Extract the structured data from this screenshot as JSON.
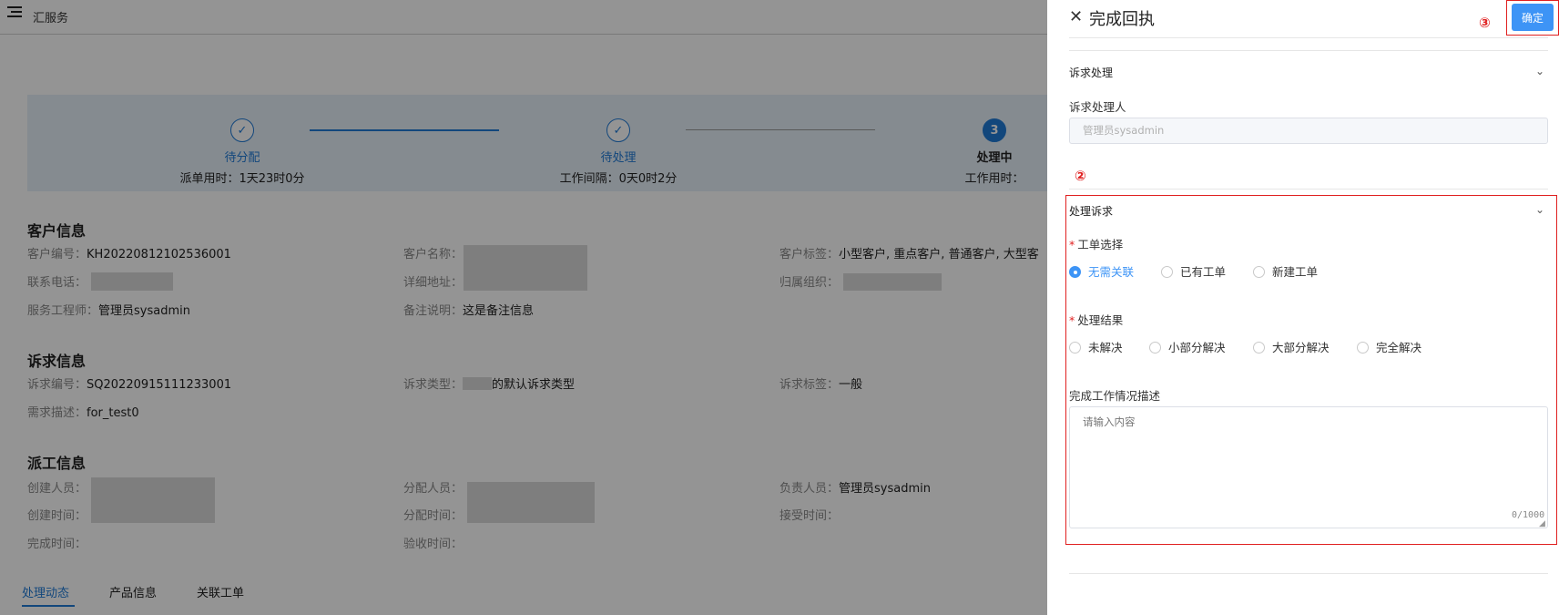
{
  "app": {
    "title": "汇服务"
  },
  "steps": [
    {
      "icon": "check-icon",
      "mark": "✓",
      "label": "待分配",
      "sub": "派单用时：1天23时0分"
    },
    {
      "icon": "check-icon",
      "mark": "✓",
      "label": "待处理",
      "sub": "工作间隔：0天0时2分"
    },
    {
      "icon": "step-number",
      "mark": "3",
      "label": "处理中",
      "sub": "工作用时："
    }
  ],
  "customer": {
    "title": "客户信息",
    "code_label": "客户编号：",
    "code": "KH20220812102536001",
    "name_label": "客户名称：",
    "tags_label": "客户标签：",
    "tags": "小型客户, 重点客户, 普通客户, 大型客",
    "phone_label": "联系电话：",
    "address_label": "详细地址：",
    "org_label": "归属组织：",
    "engineer_label": "服务工程师：",
    "engineer": "管理员sysadmin",
    "remark_label": "备注说明：",
    "remark": "这是备注信息"
  },
  "request": {
    "title": "诉求信息",
    "code_label": "诉求编号：",
    "code": "SQ20220915111233001",
    "type_label": "诉求类型：",
    "type": "的默认诉求类型",
    "tag_label": "诉求标签：",
    "tag": "一般",
    "desc_label": "需求描述：",
    "desc": "for_test0"
  },
  "dispatch": {
    "title": "派工信息",
    "creator_label": "创建人员：",
    "assignee_label": "分配人员：",
    "owner_label": "负责人员：",
    "owner": "管理员sysadmin",
    "created_label": "创建时间：",
    "assigned_label": "分配时间：",
    "accepted_label": "接受时间：",
    "finished_label": "完成时间：",
    "checked_label": "验收时间："
  },
  "tabs": [
    "处理动态",
    "产品信息",
    "关联工单"
  ],
  "drawer": {
    "close": "✕",
    "title": "完成回执",
    "ok": "确定",
    "panel1": {
      "title": "诉求处理",
      "handler_label": "诉求处理人",
      "handler_value": "管理员sysadmin"
    },
    "panel2": {
      "title": "处理诉求",
      "order_label": "工单选择",
      "order_options": [
        "无需关联",
        "已有工单",
        "新建工单"
      ],
      "result_label": "处理结果",
      "result_options": [
        "未解决",
        "小部分解决",
        "大部分解决",
        "完全解决"
      ],
      "desc_label": "完成工作情况描述",
      "desc_placeholder": "请输入内容",
      "counter": "0/1000"
    },
    "chevron": "⌄"
  },
  "markers": {
    "two": "②",
    "three": "③"
  },
  "colors": {
    "accent": "#3d94f6",
    "highlight": "#e02020"
  }
}
